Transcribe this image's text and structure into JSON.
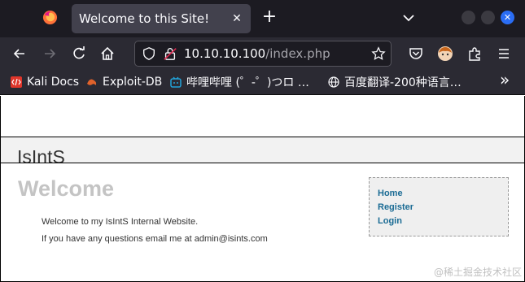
{
  "browser": {
    "tab_title": "Welcome to this Site!",
    "tab_close_glyph": "✕",
    "new_tab_glyph": "+",
    "url_host": "10.10.10.100",
    "url_path": "/index.php",
    "icons": [
      "firefox-logo",
      "back-arrow-icon",
      "forward-arrow-icon",
      "reload-icon",
      "home-icon",
      "shield-icon",
      "insecure-lock-icon",
      "bookmark-star-icon",
      "pocket-icon",
      "profile-avatar-icon",
      "extensions-icon",
      "menu-icon",
      "tab-list-chevron-icon"
    ],
    "window_close_glyph": "✕"
  },
  "bookmarks": [
    {
      "label": "Kali Docs",
      "icon": "kali-docs-icon",
      "color": "#e0362b"
    },
    {
      "label": "Exploit-DB",
      "icon": "exploit-db-icon",
      "color": "#e0622b"
    },
    {
      "label": "哔哩哔哩 (゜-゜)つロ …",
      "icon": "bilibili-icon",
      "color": "#22a3d9"
    },
    {
      "label": "百度翻译-200种语言…",
      "icon": "globe-icon",
      "color": "#fbfbfe"
    }
  ],
  "bookmarks_overflow": "»",
  "site": {
    "name": "IsIntS",
    "heading": "Welcome",
    "paragraphs": [
      "Welcome to my IsIntS Internal Website.",
      "If you have any questions email me at admin@isints.com"
    ],
    "nav_links": [
      "Home",
      "Register",
      "Login"
    ],
    "link_color": "#1a6b94"
  },
  "watermark": "@稀土掘金技术社区"
}
